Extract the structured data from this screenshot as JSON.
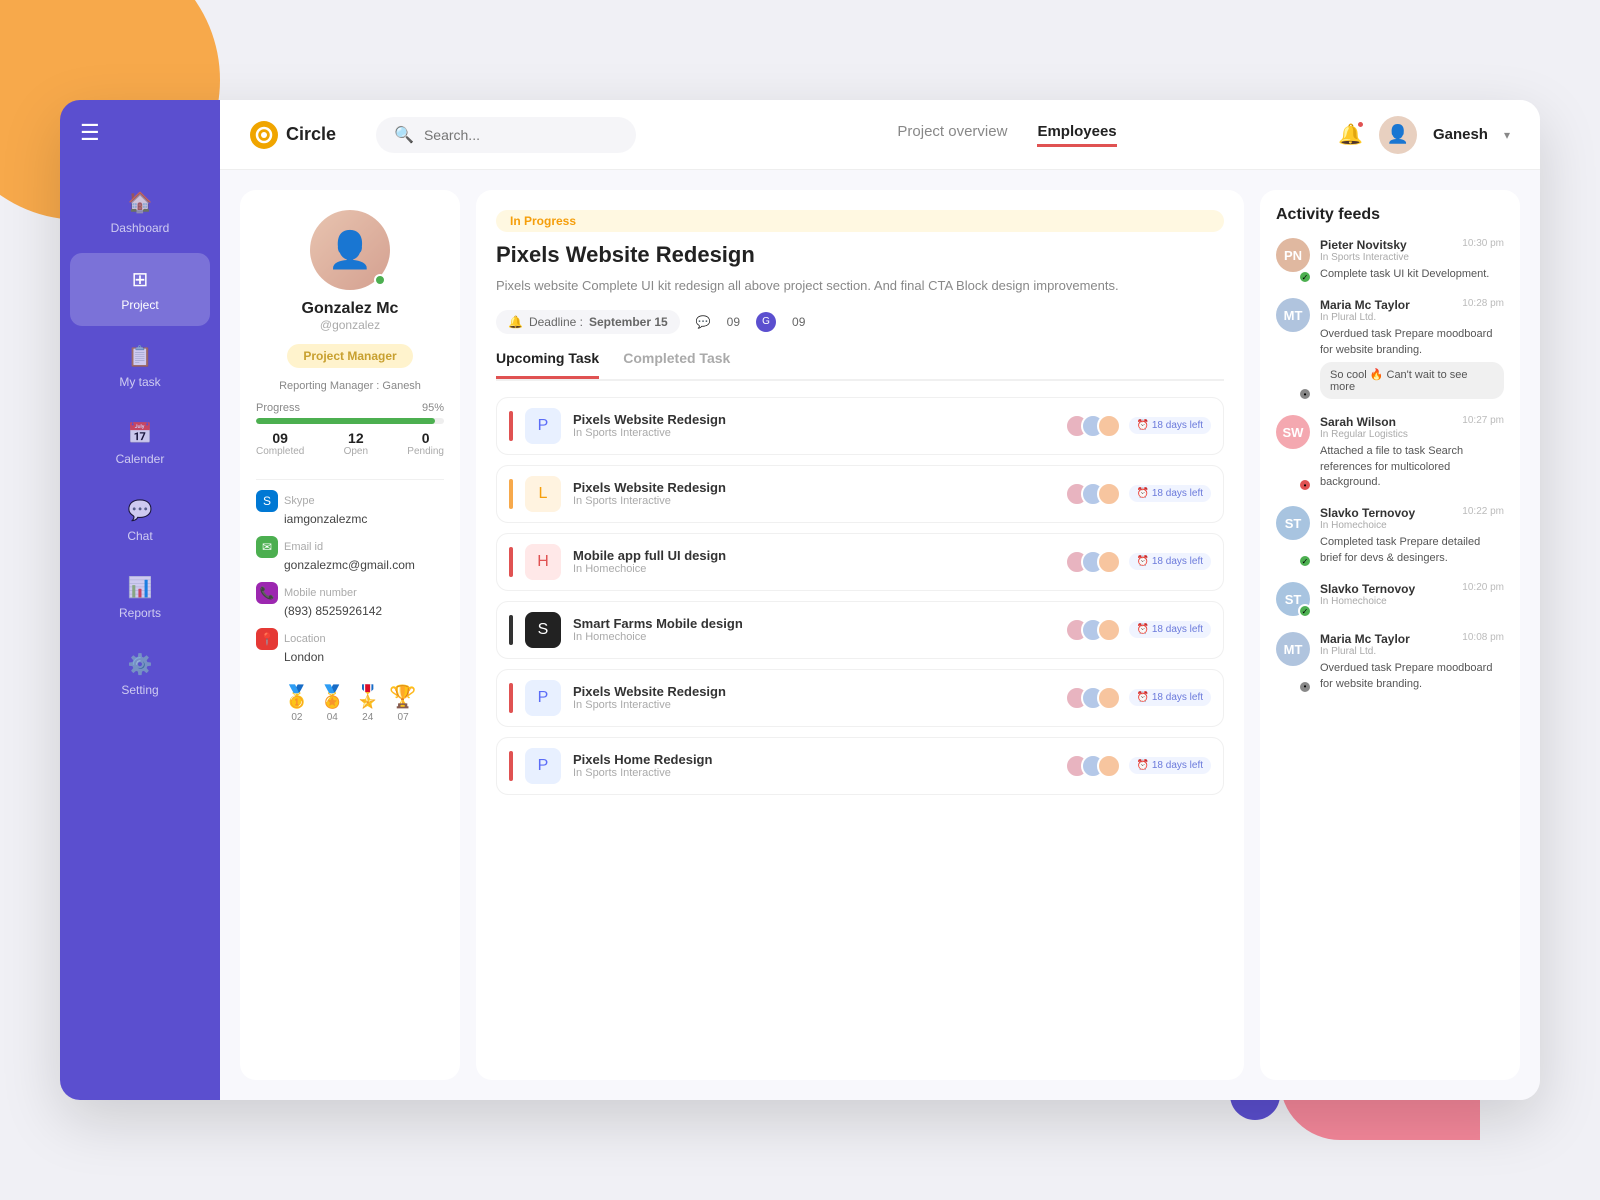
{
  "app": {
    "name": "Circle",
    "logo_emoji": "⭕"
  },
  "header": {
    "search_placeholder": "Search...",
    "nav_items": [
      {
        "label": "Project overview",
        "active": false
      },
      {
        "label": "Employees",
        "active": true
      }
    ],
    "user_name": "Ganesh",
    "notif_has_dot": true
  },
  "sidebar": {
    "items": [
      {
        "label": "Dashboard",
        "icon": "🏠",
        "active": false,
        "id": "dashboard"
      },
      {
        "label": "Project",
        "icon": "⊞",
        "active": true,
        "id": "project"
      },
      {
        "label": "My task",
        "icon": "📋",
        "active": false,
        "id": "mytask"
      },
      {
        "label": "Calender",
        "icon": "📅",
        "active": false,
        "id": "calender"
      },
      {
        "label": "Chat",
        "icon": "💬",
        "active": false,
        "id": "chat"
      },
      {
        "label": "Reports",
        "icon": "📊",
        "active": false,
        "id": "reports"
      },
      {
        "label": "Setting",
        "icon": "⚙️",
        "active": false,
        "id": "setting"
      }
    ]
  },
  "profile": {
    "name": "Gonzalez Mc",
    "handle": "@gonzalez",
    "role": "Project Manager",
    "reporting_manager": "Reporting Manager : Ganesh",
    "progress_pct": 95,
    "progress_label": "Progress",
    "progress_value": "95%",
    "stats": [
      {
        "num": "09",
        "label": "Completed"
      },
      {
        "num": "12",
        "label": "Open"
      },
      {
        "num": "0",
        "label": "Pending"
      }
    ],
    "contacts": [
      {
        "type": "Skype",
        "value": "iamgonzalezmc",
        "color": "#0078d4",
        "icon": "S"
      },
      {
        "type": "Email id",
        "value": "gonzalezmc@gmail.com",
        "color": "#4caf50",
        "icon": "✉"
      },
      {
        "type": "Mobile number",
        "value": "(893) 8525926142",
        "color": "#9c27b0",
        "icon": "📞"
      },
      {
        "type": "Location",
        "value": "London",
        "color": "#e53935",
        "icon": "📍"
      }
    ],
    "badges": [
      {
        "num": "02",
        "icon": "🥇"
      },
      {
        "num": "04",
        "icon": "🏅"
      },
      {
        "num": "24",
        "icon": "🎖️"
      },
      {
        "num": "07",
        "icon": "🏆"
      }
    ]
  },
  "project": {
    "status": "In Progress",
    "title": "Pixels Website Redesign",
    "description": "Pixels website Complete UI kit redesign all above project section. And final CTA Block design improvements.",
    "deadline_label": "Deadline :",
    "deadline_date": "September 15",
    "comment_count": "09",
    "member_count": "09"
  },
  "tasks": {
    "tabs": [
      {
        "label": "Upcoming Task",
        "active": true
      },
      {
        "label": "Completed Task",
        "active": false
      }
    ],
    "items": [
      {
        "name": "Pixels Website Redesign",
        "sub": "In Sports Interactive",
        "bar_color": "#e05252",
        "logo_bg": "#e8f0ff",
        "logo_text": "P",
        "logo_color": "#5b6cf7",
        "days": "18 days left"
      },
      {
        "name": "Pixels Website Redesign",
        "sub": "In Sports Interactive",
        "bar_color": "#f7a94b",
        "logo_bg": "#fff3e0",
        "logo_text": "L",
        "logo_color": "#f59e0b",
        "days": "18 days left"
      },
      {
        "name": "Mobile app full UI design",
        "sub": "In Homechoice",
        "bar_color": "#e05252",
        "logo_bg": "#ffe8e8",
        "logo_text": "H",
        "logo_color": "#e05252",
        "days": "18 days left"
      },
      {
        "name": "Smart Farms Mobile design",
        "sub": "In Homechoice",
        "bar_color": "#333",
        "logo_bg": "#222",
        "logo_text": "S",
        "logo_color": "#fff",
        "days": "18 days left"
      },
      {
        "name": "Pixels Website Redesign",
        "sub": "In Sports Interactive",
        "bar_color": "#e05252",
        "logo_bg": "#e8f0ff",
        "logo_text": "P",
        "logo_color": "#5b6cf7",
        "days": "18 days left"
      },
      {
        "name": "Pixels Home Redesign",
        "sub": "In Sports Interactive",
        "bar_color": "#e05252",
        "logo_bg": "#e8f0ff",
        "logo_text": "P",
        "logo_color": "#5b6cf7",
        "days": "18 days left"
      }
    ]
  },
  "activity": {
    "title": "Activity feeds",
    "items": [
      {
        "name": "Pieter Novitsky",
        "org": "In Sports Interactive",
        "time": "10:30 pm",
        "text": "Complete task UI kit Development.",
        "status": "check",
        "status_color": "#4caf50",
        "avatar_color": "#e0b8a0",
        "avatar_text": "PN"
      },
      {
        "name": "Maria Mc Taylor",
        "org": "In Plural Ltd.",
        "time": "10:28 pm",
        "text": "Overdued task Prepare moodboard for website branding.",
        "comment": "So cool 🔥 Can't wait to see more",
        "status": "dot",
        "status_color": "#888",
        "avatar_color": "#b0c4de",
        "avatar_text": "MT"
      },
      {
        "name": "Sarah Wilson",
        "org": "In Regular Logistics",
        "time": "10:27 pm",
        "text": "Attached a file to task Search references for multicolored background.",
        "status": "dot",
        "status_color": "#e05252",
        "avatar_color": "#f4a8b0",
        "avatar_text": "SW"
      },
      {
        "name": "Slavko Ternovoy",
        "org": "In Homechoice",
        "time": "10:22 pm",
        "text": "Completed task Prepare detailed brief for devs & desingers.",
        "status": "check",
        "status_color": "#4caf50",
        "avatar_color": "#a8c4e0",
        "avatar_text": "ST"
      },
      {
        "name": "Slavko Ternovoy",
        "org": "In Homechoice",
        "time": "10:20 pm",
        "text": "",
        "status": "check",
        "status_color": "#4caf50",
        "avatar_color": "#a8c4e0",
        "avatar_text": "ST"
      },
      {
        "name": "Maria Mc Taylor",
        "org": "In Plural Ltd.",
        "time": "10:08 pm",
        "text": "Overdued task Prepare moodboard for website branding.",
        "status": "dot",
        "status_color": "#888",
        "avatar_color": "#b0c4de",
        "avatar_text": "MT"
      }
    ]
  }
}
